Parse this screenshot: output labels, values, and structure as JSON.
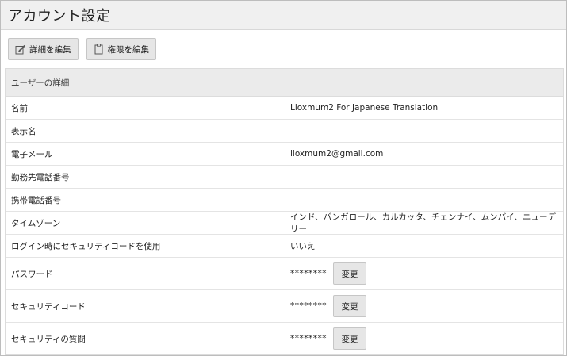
{
  "header": {
    "title": "アカウント設定"
  },
  "toolbar": {
    "edit_details_label": "詳細を編集",
    "edit_permissions_label": "権限を編集"
  },
  "panel": {
    "title": "ユーザーの詳細",
    "rows": [
      {
        "label": "名前",
        "value": "Lioxmum2 For Japanese Translation"
      },
      {
        "label": "表示名",
        "value": ""
      },
      {
        "label": "電子メール",
        "value": "lioxmum2@gmail.com"
      },
      {
        "label": "勤務先電話番号",
        "value": ""
      },
      {
        "label": "携帯電話番号",
        "value": ""
      },
      {
        "label": "タイムゾーン",
        "value": "インド、バンガロール、カルカッタ、チェンナイ、ムンバイ、ニューデリー"
      },
      {
        "label": "ログイン時にセキュリティコードを使用",
        "value": "いいえ"
      },
      {
        "label": "パスワード",
        "value": "********",
        "button": "変更"
      },
      {
        "label": "セキュリティコード",
        "value": "********",
        "button": "変更"
      },
      {
        "label": "セキュリティの質問",
        "value": "********",
        "button": "変更"
      }
    ]
  },
  "icons": {
    "edit": "edit-icon",
    "clipboard": "clipboard-icon"
  }
}
